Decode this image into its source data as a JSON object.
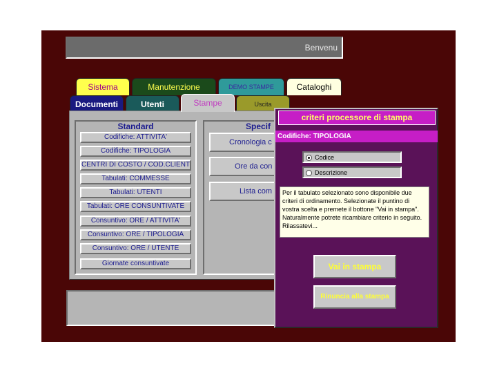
{
  "header": {
    "welcome_text": "Benvenu"
  },
  "tabs_row1": [
    {
      "label": "Sistema",
      "color": "#ffff4d"
    },
    {
      "label": "Manutenzione",
      "color": "#1b4a1b"
    },
    {
      "label": "DEMO STAMPE",
      "color": "#2f9a9a"
    },
    {
      "label": "Cataloghi",
      "color": "#ffffe0"
    }
  ],
  "tabs_row2": [
    {
      "label": "Documenti",
      "color": "#1a1a80"
    },
    {
      "label": "Utenti",
      "color": "#1a5a5a"
    },
    {
      "label": "Stampe",
      "color": "#c8c8c8",
      "active": true
    },
    {
      "label": "Uscita",
      "color": "#9a9a2a"
    }
  ],
  "standard": {
    "title": "Standard",
    "buttons": [
      "Codifiche: ATTIVITA'",
      "Codifiche: TIPOLOGIA",
      "CENTRI DI COSTO / COD.CLIENTE",
      "Tabulati: COMMESSE",
      "Tabulati: UTENTI",
      "Tabulati: ORE CONSUNTIVATE",
      "Consuntivo: ORE / ATTIVITA'",
      "Consuntivo: ORE / TIPOLOGIA",
      "Consuntivo: ORE / UTENTE",
      "Giornate consuntivate"
    ]
  },
  "specific": {
    "title": "Specif",
    "buttons": [
      "Cronologia c",
      "Ore da con",
      "Lista com"
    ]
  },
  "dialog": {
    "title": "criteri processore di stampa",
    "subtitle": "Codifiche: TIPOLOGIA",
    "radio_codice": "Codice",
    "radio_descrizione": "Descrizione",
    "selected": "Codice",
    "info_text": "Per il tabulato selezionato sono disponibile due criteri di ordinamento. Selezionate il puntino di vostra scelta e premete il bottone \"Vai in stampa\". Naturalmente potrete ricambiare criterio in seguito. Rilassatevi...",
    "btn_print": "Vai in stampa",
    "btn_cancel": "Rinuncia alla stampa"
  }
}
